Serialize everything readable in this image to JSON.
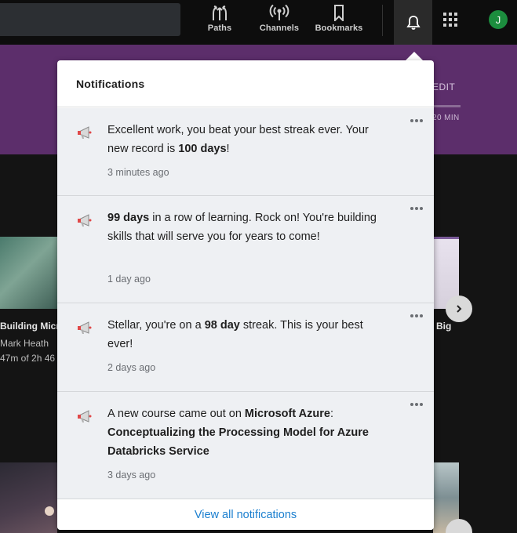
{
  "nav": {
    "paths_label": "Paths",
    "channels_label": "Channels",
    "bookmarks_label": "Bookmarks",
    "avatar_initial": "J"
  },
  "banner": {
    "edit_label": "EDIT",
    "time_label": "20 MIN"
  },
  "background_cards": {
    "left_title": "Building Micr",
    "left_author": "Mark Heath",
    "left_progress": "47m of 2h 46",
    "right_title": "Big"
  },
  "notifications": {
    "title": "Notifications",
    "items": [
      {
        "text_before": "Excellent work, you beat your best streak ever. Your new record is ",
        "bold": "100 days",
        "text_after": "!",
        "time": "3 minutes ago"
      },
      {
        "bold": "99 days",
        "text_after": " in a row of learning. Rock on! You're building skills that will serve you for years to come!",
        "time": "1 day ago"
      },
      {
        "text_before": "Stellar, you're on a ",
        "bold": "98 day",
        "text_after": " streak. This is your best ever!",
        "time": "2 days ago"
      },
      {
        "text_before": "A new course came out on ",
        "bold": "Microsoft Azure",
        "text_middle": ": ",
        "bold2": "Conceptualizing the Processing Model for Azure Databricks Service",
        "time": "3 days ago"
      }
    ],
    "footer_link": "View all notifications"
  },
  "colors": {
    "banner": "#5c2e6b",
    "link": "#1b7fcf",
    "avatar": "#1c8d3e"
  }
}
